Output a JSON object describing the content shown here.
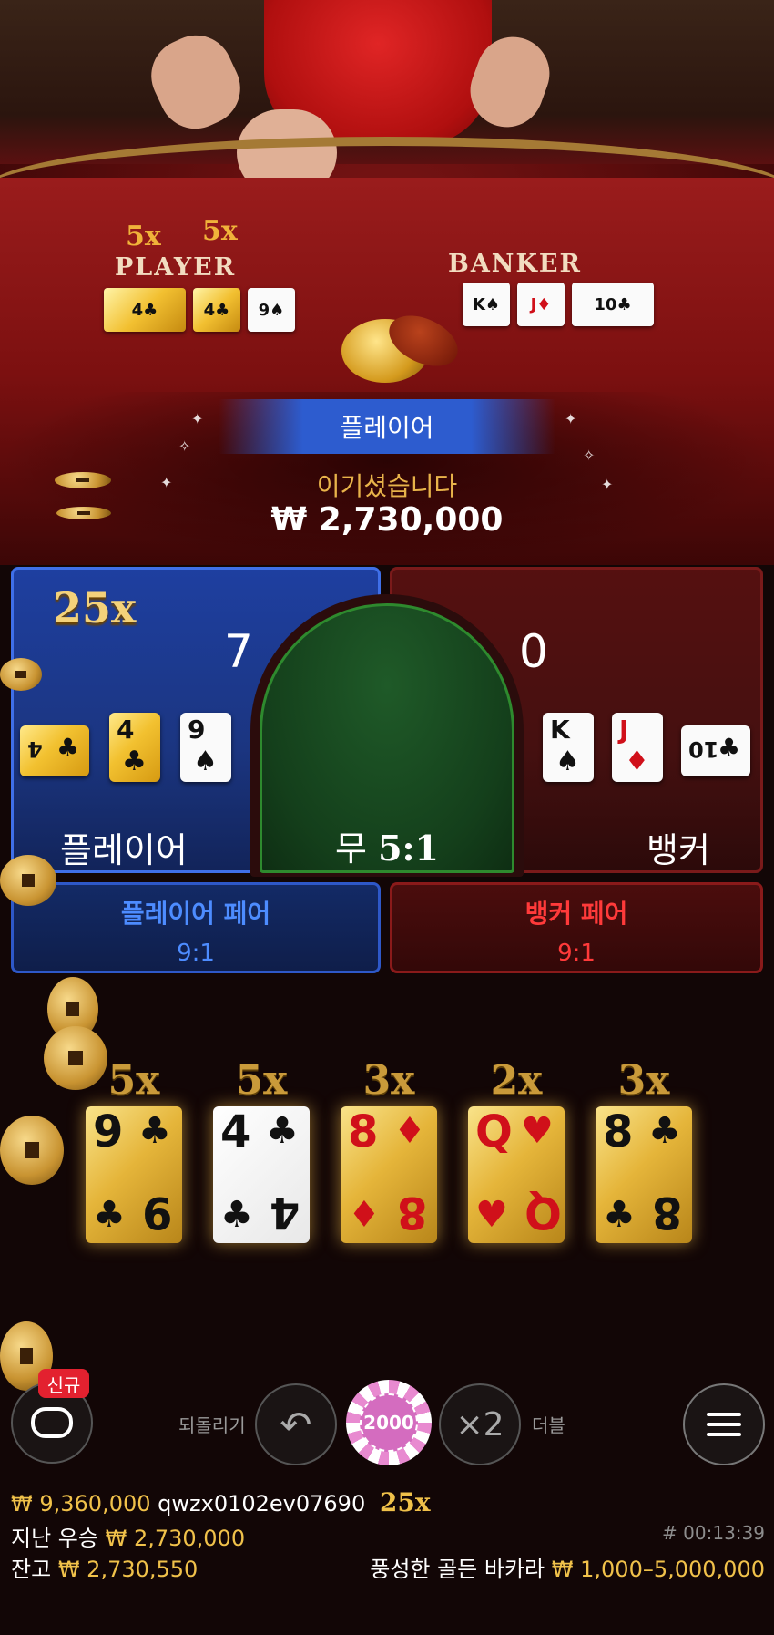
{
  "table": {
    "felt_player_label": "PLAYER",
    "felt_banker_label": "BANKER",
    "felt_player_mults": [
      "5x",
      "5x"
    ],
    "felt_player_cards": [
      "4♣",
      "4♣",
      "9♠"
    ],
    "felt_banker_cards": [
      "K♠",
      "J♦",
      "10♣"
    ]
  },
  "win_banner": {
    "winner": "플레이어",
    "message": "이기셨습니다",
    "amount": "₩ 2,730,000"
  },
  "bets": {
    "player": {
      "label": "플레이어",
      "score": "7",
      "multiplier": "25x",
      "cards": [
        {
          "rank": "4",
          "suit": "♣",
          "color": "black",
          "style": "gold",
          "rotated": true
        },
        {
          "rank": "4",
          "suit": "♣",
          "color": "black",
          "style": "gold",
          "rotated": false
        },
        {
          "rank": "9",
          "suit": "♠",
          "color": "black",
          "style": "white",
          "rotated": false
        }
      ]
    },
    "tie": {
      "label": "무",
      "odds": "5:1"
    },
    "banker": {
      "label": "뱅커",
      "score": "0",
      "cards": [
        {
          "rank": "K",
          "suit": "♠",
          "color": "black",
          "style": "white",
          "rotated": false
        },
        {
          "rank": "J",
          "suit": "♦",
          "color": "red",
          "style": "white",
          "rotated": false
        },
        {
          "rank": "10",
          "suit": "♣",
          "color": "black",
          "style": "white",
          "rotated": true
        }
      ]
    },
    "player_pair": {
      "label": "플레이어 페어",
      "odds": "9:1"
    },
    "banker_pair": {
      "label": "뱅커 페어",
      "odds": "9:1"
    }
  },
  "lightning_cards": [
    {
      "mult": "5x",
      "rank": "9",
      "suit": "♣",
      "color": "black",
      "style": "gold"
    },
    {
      "mult": "5x",
      "rank": "4",
      "suit": "♣",
      "color": "black",
      "style": "white"
    },
    {
      "mult": "3x",
      "rank": "8",
      "suit": "♦",
      "color": "red",
      "style": "gold"
    },
    {
      "mult": "2x",
      "rank": "Q",
      "suit": "♥",
      "color": "red",
      "style": "gold"
    },
    {
      "mult": "3x",
      "rank": "8",
      "suit": "♣",
      "color": "black",
      "style": "gold"
    }
  ],
  "controls": {
    "new_badge": "신규",
    "undo_label": "되돌리기",
    "undo_icon": "↶",
    "chip_value": "2000",
    "double_icon": "×2",
    "double_label": "더블"
  },
  "footer": {
    "win_amount": "₩ 9,360,000",
    "win_user": "qwzx0102ev07690",
    "win_mult": "25x",
    "last_win_label": "지난 우승",
    "last_win_amount": "₩ 2,730,000",
    "timer": "# 00:13:39",
    "balance_label": "잔고",
    "balance_amount": "₩ 2,730,550",
    "table_name": "풍성한 골든 바카라",
    "limits": "₩ 1,000–5,000,000"
  },
  "colors": {
    "player_blue": "#1e3fa0",
    "banker_red": "#551010",
    "tie_green": "#1f5a28",
    "gold": "#f0c14a"
  }
}
